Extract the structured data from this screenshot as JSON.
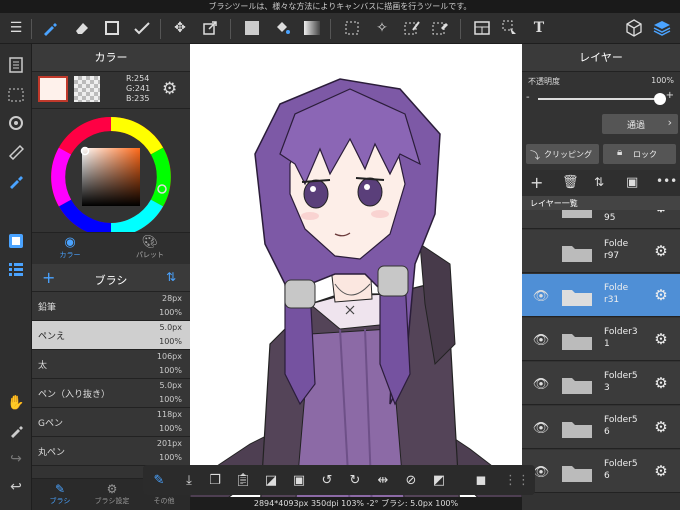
{
  "hint": "ブラシツールは、様々な方法によりキャンバスに描画を行うツールです。",
  "status": "2894*4093px 350dpi 103% -2° ブラシ: 5.0px 100%",
  "colors": {
    "current": "#FEF1EB",
    "accent": "#4aa3ff",
    "selected_layer": "#4f8fd6"
  },
  "color_panel": {
    "title": "カラー",
    "rgb": {
      "r": "R:254",
      "g": "G:241",
      "b": "B:235"
    },
    "tabs": [
      {
        "label": "カラー"
      },
      {
        "label": "パレット"
      }
    ]
  },
  "brush_panel": {
    "title": "ブラシ",
    "brushes": [
      {
        "name": "鉛筆",
        "size": "28px",
        "opacity": "100%"
      },
      {
        "name": "ペンえ",
        "size": "5.0px",
        "opacity": "100%"
      },
      {
        "name": "太",
        "size": "106px",
        "opacity": "100%"
      },
      {
        "name": "ペン（入り抜き）",
        "size": "5.0px",
        "opacity": "100%"
      },
      {
        "name": "Gペン",
        "size": "118px",
        "opacity": "100%"
      },
      {
        "name": "丸ペン",
        "size": "201px",
        "opacity": "100%"
      }
    ],
    "bottom_tabs": [
      {
        "label": "ブラシ"
      },
      {
        "label": "ブラシ設定"
      },
      {
        "label": "その他"
      }
    ]
  },
  "layer_panel": {
    "title": "レイヤー",
    "opacity_label": "不透明度",
    "opacity_value": "100%",
    "opacity": 1.0,
    "blend_mode": "通過",
    "clipping": "クリッピング",
    "lock": "ロック",
    "list_header": "レイヤー一覧",
    "layers": [
      {
        "name": "95",
        "visible": false,
        "selected": false
      },
      {
        "name": "Folder97",
        "visible": false,
        "selected": false
      },
      {
        "name": "Folder31",
        "visible": true,
        "selected": true
      },
      {
        "name": "Folder31",
        "visible": true,
        "selected": false
      },
      {
        "name": "Folder53",
        "visible": true,
        "selected": false
      },
      {
        "name": "Folder56",
        "visible": true,
        "selected": false
      },
      {
        "name": "Folder56",
        "visible": true,
        "selected": false
      }
    ]
  },
  "layer_names_display": [
    "95",
    "Folde\nr97",
    "Folde\nr31",
    "Folder3\n1",
    "Folder5\n3",
    "Folder5\n6",
    "Folder5\n6"
  ]
}
